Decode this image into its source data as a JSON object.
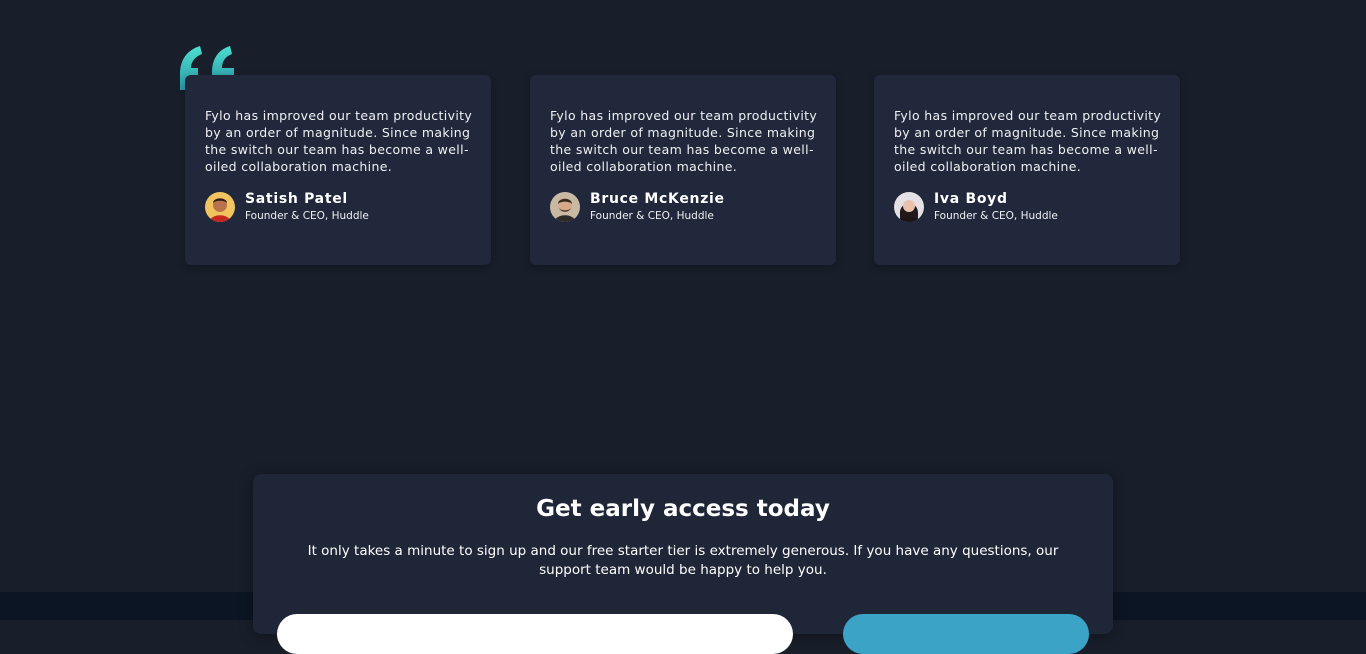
{
  "testimonials": [
    {
      "quote": "Fylo has improved our team productivity by an order of magnitude. Since making the switch our team has become a well-oiled collaboration machine.",
      "name": "Satish Patel",
      "role": "Founder & CEO, Huddle"
    },
    {
      "quote": "Fylo has improved our team productivity by an order of magnitude. Since making the switch our team has become a well-oiled collaboration machine.",
      "name": "Bruce McKenzie",
      "role": "Founder & CEO, Huddle"
    },
    {
      "quote": "Fylo has improved our team productivity by an order of magnitude. Since making the switch our team has become a well-oiled collaboration machine.",
      "name": "Iva Boyd",
      "role": "Founder & CEO, Huddle"
    }
  ],
  "early_access": {
    "title": "Get early access today",
    "text": "It only takes a minute to sign up and our free starter tier is extremely generous. If you have any questions, our support team would be happy to help you."
  },
  "colors": {
    "background": "#181e2a",
    "card": "#21283b",
    "cta_card": "#1f2637",
    "footer": "#0c1523",
    "accent_teal": "#4ce0d0",
    "button": "#3ba3c5"
  },
  "icons": {
    "quote": "quote-icon"
  }
}
